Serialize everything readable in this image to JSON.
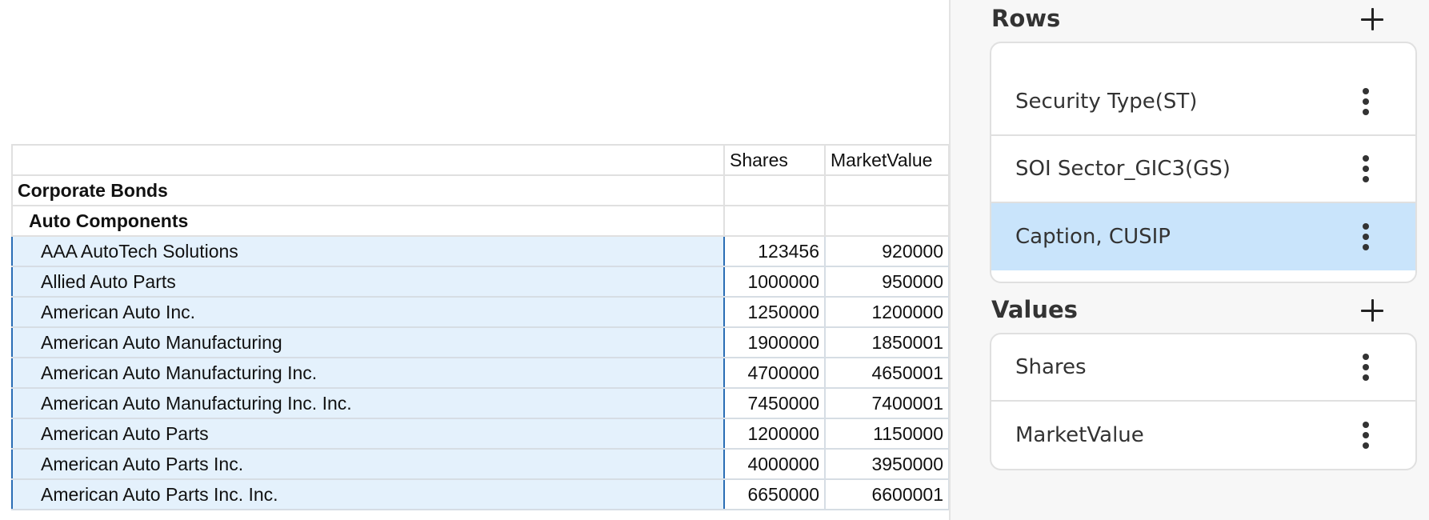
{
  "table": {
    "columns": [
      "",
      "Shares",
      "MarketValue"
    ],
    "rows": [
      {
        "level": 0,
        "label": "Corporate Bonds",
        "shares": "",
        "market_value": ""
      },
      {
        "level": 1,
        "label": "Auto Components",
        "shares": "",
        "market_value": ""
      },
      {
        "level": 2,
        "label": "AAA AutoTech Solutions",
        "shares": "123456",
        "market_value": "920000"
      },
      {
        "level": 2,
        "label": "Allied Auto Parts",
        "shares": "1000000",
        "market_value": "950000"
      },
      {
        "level": 2,
        "label": "American Auto Inc.",
        "shares": "1250000",
        "market_value": "1200000"
      },
      {
        "level": 2,
        "label": "American Auto Manufacturing",
        "shares": "1900000",
        "market_value": "1850001"
      },
      {
        "level": 2,
        "label": "American Auto Manufacturing Inc.",
        "shares": "4700000",
        "market_value": "4650001"
      },
      {
        "level": 2,
        "label": "American Auto Manufacturing Inc. Inc.",
        "shares": "7450000",
        "market_value": "7400001"
      },
      {
        "level": 2,
        "label": "American Auto Parts",
        "shares": "1200000",
        "market_value": "1150000"
      },
      {
        "level": 2,
        "label": "American Auto Parts Inc.",
        "shares": "4000000",
        "market_value": "3950000"
      },
      {
        "level": 2,
        "label": "American Auto Parts Inc. Inc.",
        "shares": "6650000",
        "market_value": "6600001"
      }
    ]
  },
  "panel": {
    "rows": {
      "title": "Rows",
      "add_icon": "plus-icon",
      "fields": [
        {
          "label": "Security Type(ST)",
          "selected": false
        },
        {
          "label": "SOI Sector_GIC3(GS)",
          "selected": false
        },
        {
          "label": "Caption, CUSIP",
          "selected": true
        }
      ]
    },
    "values": {
      "title": "Values",
      "add_icon": "plus-icon",
      "fields": [
        {
          "label": "Shares",
          "selected": false
        },
        {
          "label": "MarketValue",
          "selected": false
        }
      ]
    }
  },
  "colors": {
    "selection_fill": "#e4f1fc",
    "selection_border": "#2a6db5",
    "selected_field": "#c9e4fb"
  }
}
